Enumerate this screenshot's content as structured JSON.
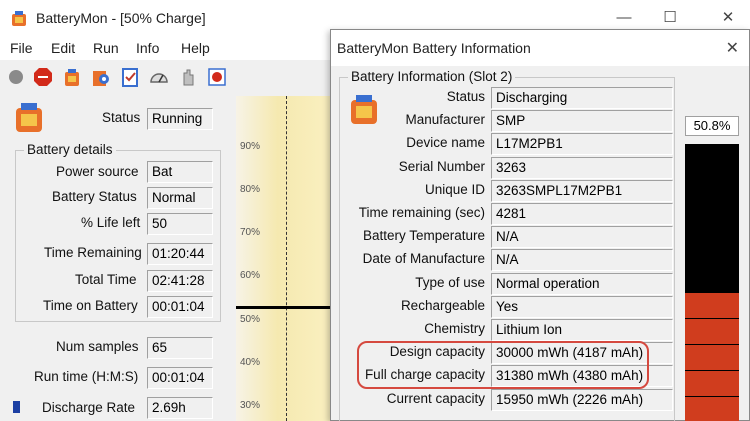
{
  "window": {
    "title": "BatteryMon - [50% Charge]",
    "controls": {
      "minimize": "—",
      "maximize": "☐",
      "close": "✕"
    }
  },
  "menu": {
    "file": "File",
    "edit": "Edit",
    "run": "Run",
    "info": "Info",
    "help": "Help"
  },
  "main": {
    "status_label": "Status",
    "status_value": "Running",
    "battery_details_title": "Battery details",
    "details": [
      {
        "label": "Power source",
        "value": "Bat"
      },
      {
        "label": "Battery Status",
        "value": "Normal"
      },
      {
        "label": "% Life left",
        "value": "50"
      },
      {
        "label": "Time Remaining",
        "value": "01:20:44"
      },
      {
        "label": "Total Time",
        "value": "02:41:28"
      },
      {
        "label": "Time on Battery",
        "value": "00:01:04"
      }
    ],
    "num_samples_label": "Num samples",
    "num_samples_value": "65",
    "run_time_label": "Run time (H:M:S)",
    "run_time_value": "00:01:04",
    "discharge_rate_label": "Discharge Rate",
    "discharge_rate_value": "2.69h"
  },
  "graph": {
    "ticks": [
      "90%",
      "80%",
      "70%",
      "60%",
      "50%",
      "40%",
      "30%"
    ],
    "current_level": 50,
    "colors": {
      "fill": "#f5e9b0",
      "line": "#000000"
    }
  },
  "dialog": {
    "title": "BatteryMon Battery Information",
    "close": "✕",
    "group_title": "Battery Information (Slot 2)",
    "rows": [
      {
        "label": "Status",
        "value": "Discharging"
      },
      {
        "label": "Manufacturer",
        "value": "SMP"
      },
      {
        "label": "Device name",
        "value": "L17M2PB1"
      },
      {
        "label": "Serial Number",
        "value": "3263"
      },
      {
        "label": "Unique ID",
        "value": "3263SMPL17M2PB1"
      },
      {
        "label": "Time remaining (sec)",
        "value": "4281"
      },
      {
        "label": "Battery Temperature",
        "value": "N/A"
      },
      {
        "label": "Date of Manufacture",
        "value": "N/A"
      },
      {
        "label": "Type of use",
        "value": "Normal operation"
      },
      {
        "label": "Rechargeable",
        "value": "Yes"
      },
      {
        "label": "Chemistry",
        "value": "Lithium Ion"
      },
      {
        "label": "Design capacity",
        "value": "30000 mWh (4187 mAh)"
      },
      {
        "label": "Full charge capacity",
        "value": "31380 mWh (4380 mAh)"
      },
      {
        "label": "Current capacity",
        "value": "15950 mWh (2226 mAh)"
      }
    ],
    "meter_percent": "50.8%",
    "meter_level": 0.508,
    "colors": {
      "highlight": "#d5493f",
      "bar_fill": "#d03d1e",
      "bar_empty": "#000000"
    }
  },
  "icons": [
    "battery-icon",
    "stop-icon",
    "record-icon",
    "gear-icon",
    "checklist-icon",
    "gauge-icon",
    "hand-icon",
    "tools-icon"
  ]
}
